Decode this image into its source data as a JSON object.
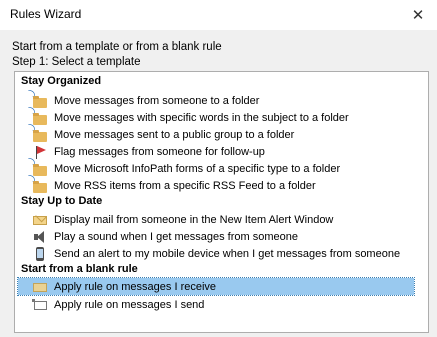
{
  "window": {
    "title": "Rules Wizard",
    "close_glyph": "✕"
  },
  "intro_text": "Start from a template or from a blank rule",
  "step_label": "Step 1: Select a template",
  "groups": [
    {
      "header": "Stay Organized",
      "items": [
        {
          "icon": "move-folder-icon",
          "label": "Move messages from someone to a folder"
        },
        {
          "icon": "move-folder-icon",
          "label": "Move messages with specific words in the subject to a folder"
        },
        {
          "icon": "move-folder-icon",
          "label": "Move messages sent to a public group to a folder"
        },
        {
          "icon": "red-flag-icon",
          "label": "Flag messages from someone for follow-up"
        },
        {
          "icon": "move-folder-icon",
          "label": "Move Microsoft InfoPath forms of a specific type to a folder"
        },
        {
          "icon": "move-folder-icon",
          "label": "Move RSS items from a specific RSS Feed to a folder"
        }
      ]
    },
    {
      "header": "Stay Up to Date",
      "items": [
        {
          "icon": "envelope-alert-icon",
          "label": "Display mail from someone in the New Item Alert Window"
        },
        {
          "icon": "speaker-icon",
          "label": "Play a sound when I get messages from someone"
        },
        {
          "icon": "mobile-phone-icon",
          "label": "Send an alert to my mobile device when I get messages from someone"
        }
      ]
    },
    {
      "header": "Start from a blank rule",
      "items": [
        {
          "icon": "receive-rule-icon",
          "label": "Apply rule on messages I receive",
          "selected": true
        },
        {
          "icon": "send-rule-icon",
          "label": "Apply rule on messages I send"
        }
      ]
    }
  ],
  "colors": {
    "selection": "#99c9ef",
    "flag": "#d13438",
    "folder": "#e8b95c"
  }
}
